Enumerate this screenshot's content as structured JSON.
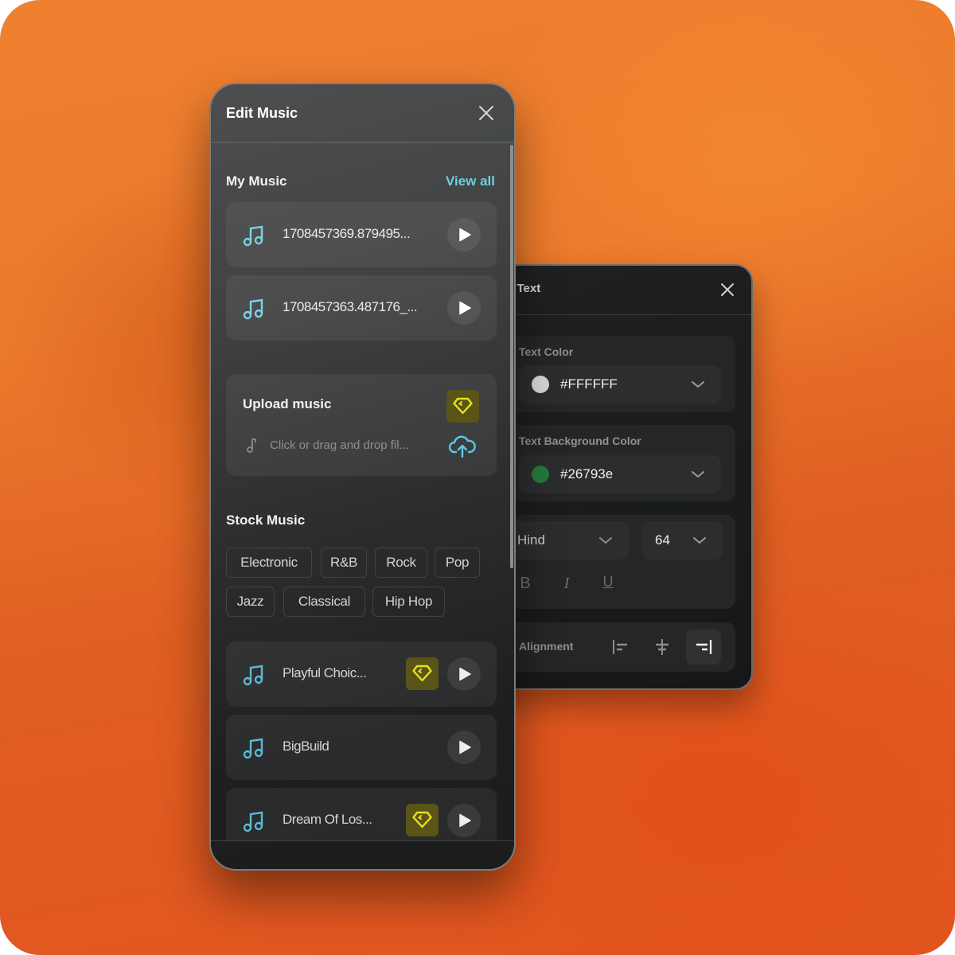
{
  "colors": {
    "accent": "#6ccfe0",
    "premium_bg": "#5a5419",
    "premium_icon": "#e8e01a",
    "text_color_swatch": "#d9d9d9",
    "bg_color_swatch": "#26793e"
  },
  "edit_music": {
    "title": "Edit Music",
    "close_icon": "close-icon",
    "my_music": {
      "title": "My Music",
      "view_all_label": "View all",
      "tracks": [
        {
          "name": "1708457369.879495...",
          "icon": "music-note-icon",
          "action": "play-icon"
        },
        {
          "name": "1708457363.487176_...",
          "icon": "music-note-icon",
          "action": "play-icon"
        }
      ]
    },
    "upload": {
      "title": "Upload music",
      "hint": "Click or drag and drop fil...",
      "premium_icon": "diamond-icon",
      "upload_icon": "cloud-upload-icon"
    },
    "stock_music": {
      "title": "Stock Music",
      "genres": [
        "Electronic",
        "R&B",
        "Rock",
        "Pop",
        "Jazz",
        "Classical",
        "Hip Hop"
      ],
      "tracks": [
        {
          "name": "Playful Choic...",
          "premium": true
        },
        {
          "name": "BigBuild",
          "premium": false
        },
        {
          "name": "Dream Of Los...",
          "premium": true
        }
      ]
    }
  },
  "edit_text": {
    "title": "Edit Text",
    "title_visible": "lit Text",
    "text_color": {
      "label": "Text Color",
      "value": "#FFFFFF"
    },
    "text_bg_color": {
      "label": "Text Background Color",
      "value": "#26793e"
    },
    "font": {
      "family": "Hind",
      "size": "64"
    },
    "format": {
      "bold": "B",
      "italic": "I",
      "underline": "U"
    },
    "alignment": {
      "label": "Alignment",
      "options": [
        "left",
        "center",
        "right"
      ],
      "selected": "right"
    }
  }
}
